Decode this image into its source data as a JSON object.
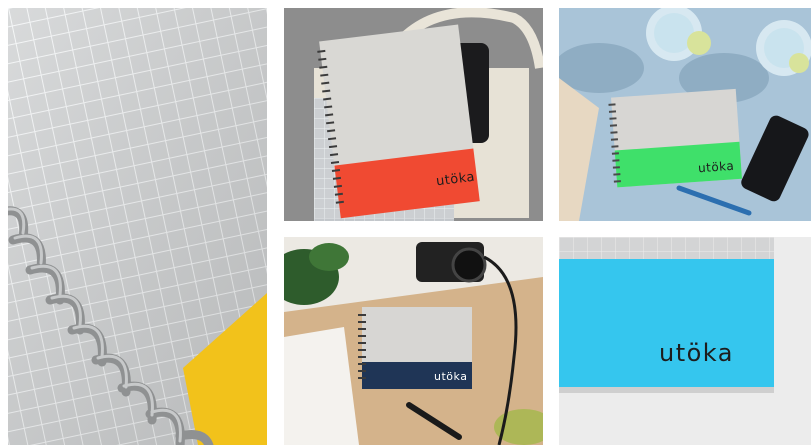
{
  "gallery": {
    "tiles": [
      {
        "id": "macro-grid-spiral",
        "accent": "#f2c21b",
        "brand_text": ""
      },
      {
        "id": "red-notebook-bag",
        "accent": "#f04a32",
        "brand_text": "utöka"
      },
      {
        "id": "green-notebook-drinks",
        "accent": "#3fe06a",
        "brand_text": "utöka"
      },
      {
        "id": "navy-notebook-desk",
        "accent": "#1f3556",
        "brand_text": "utöka"
      },
      {
        "id": "cyan-cover-closeup",
        "accent": "#35c6ee",
        "brand_text": "utöka"
      }
    ]
  }
}
